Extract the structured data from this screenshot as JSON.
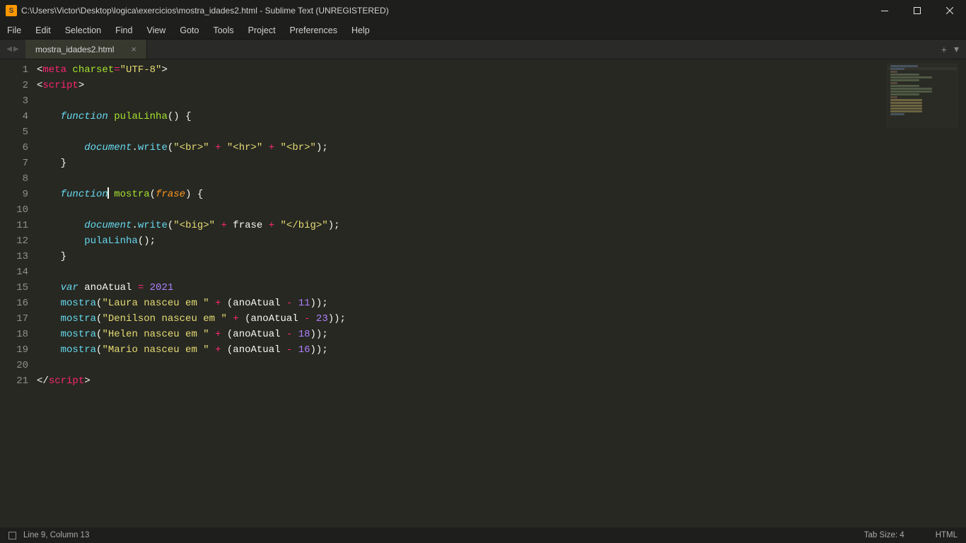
{
  "window": {
    "title": "C:\\Users\\Victor\\Desktop\\logica\\exercicios\\mostra_idades2.html - Sublime Text (UNREGISTERED)",
    "app_icon_letter": "S"
  },
  "menu": {
    "items": [
      "File",
      "Edit",
      "Selection",
      "Find",
      "View",
      "Goto",
      "Tools",
      "Project",
      "Preferences",
      "Help"
    ]
  },
  "tabs": {
    "open": [
      {
        "label": "mostra_idades2.html"
      }
    ],
    "add_tab_glyph": "+",
    "dropdown_glyph": "▾"
  },
  "editor": {
    "active_line": 9,
    "line_count": 21,
    "tokens": [
      [
        [
          "punc",
          "<"
        ],
        [
          "tag",
          "meta"
        ],
        [
          "punc",
          " "
        ],
        [
          "attr",
          "charset"
        ],
        [
          "op",
          "="
        ],
        [
          "str",
          "\"UTF-8\""
        ],
        [
          "punc",
          ">"
        ]
      ],
      [
        [
          "punc",
          "<"
        ],
        [
          "tag",
          "script"
        ],
        [
          "punc",
          ">"
        ]
      ],
      [],
      [
        [
          "punc",
          "    "
        ],
        [
          "kw",
          "function"
        ],
        [
          "punc",
          " "
        ],
        [
          "fn",
          "pulaLinha"
        ],
        [
          "punc",
          "() {"
        ]
      ],
      [],
      [
        [
          "punc",
          "        "
        ],
        [
          "obj",
          "document"
        ],
        [
          "punc",
          "."
        ],
        [
          "kw2",
          "write"
        ],
        [
          "punc",
          "("
        ],
        [
          "str",
          "\"<br>\""
        ],
        [
          "punc",
          " "
        ],
        [
          "op",
          "+"
        ],
        [
          "punc",
          " "
        ],
        [
          "str",
          "\"<hr>\""
        ],
        [
          "punc",
          " "
        ],
        [
          "op",
          "+"
        ],
        [
          "punc",
          " "
        ],
        [
          "str",
          "\"<br>\""
        ],
        [
          "punc",
          ");"
        ]
      ],
      [
        [
          "punc",
          "    }"
        ]
      ],
      [],
      [
        [
          "punc",
          "    "
        ],
        [
          "kw",
          "function"
        ],
        [
          "cursor",
          ""
        ],
        [
          "punc",
          " "
        ],
        [
          "fn",
          "mostra"
        ],
        [
          "punc",
          "("
        ],
        [
          "par",
          "frase"
        ],
        [
          "punc",
          ") {"
        ]
      ],
      [],
      [
        [
          "punc",
          "        "
        ],
        [
          "obj",
          "document"
        ],
        [
          "punc",
          "."
        ],
        [
          "kw2",
          "write"
        ],
        [
          "punc",
          "("
        ],
        [
          "str",
          "\"<big>\""
        ],
        [
          "punc",
          " "
        ],
        [
          "op",
          "+"
        ],
        [
          "punc",
          " frase "
        ],
        [
          "op",
          "+"
        ],
        [
          "punc",
          " "
        ],
        [
          "str",
          "\"</big>\""
        ],
        [
          "punc",
          ");"
        ]
      ],
      [
        [
          "punc",
          "        "
        ],
        [
          "kw2",
          "pulaLinha"
        ],
        [
          "punc",
          "();"
        ]
      ],
      [
        [
          "punc",
          "    }"
        ]
      ],
      [],
      [
        [
          "punc",
          "    "
        ],
        [
          "kw",
          "var"
        ],
        [
          "punc",
          " anoAtual "
        ],
        [
          "op",
          "="
        ],
        [
          "punc",
          " "
        ],
        [
          "num",
          "2021"
        ]
      ],
      [
        [
          "punc",
          "    "
        ],
        [
          "kw2",
          "mostra"
        ],
        [
          "punc",
          "("
        ],
        [
          "str",
          "\"Laura nasceu em \""
        ],
        [
          "punc",
          " "
        ],
        [
          "op",
          "+"
        ],
        [
          "punc",
          " (anoAtual "
        ],
        [
          "op",
          "-"
        ],
        [
          "punc",
          " "
        ],
        [
          "num",
          "11"
        ],
        [
          "punc",
          "));"
        ]
      ],
      [
        [
          "punc",
          "    "
        ],
        [
          "kw2",
          "mostra"
        ],
        [
          "punc",
          "("
        ],
        [
          "str",
          "\"Denilson nasceu em \""
        ],
        [
          "punc",
          " "
        ],
        [
          "op",
          "+"
        ],
        [
          "punc",
          " (anoAtual "
        ],
        [
          "op",
          "-"
        ],
        [
          "punc",
          " "
        ],
        [
          "num",
          "23"
        ],
        [
          "punc",
          "));"
        ]
      ],
      [
        [
          "punc",
          "    "
        ],
        [
          "kw2",
          "mostra"
        ],
        [
          "punc",
          "("
        ],
        [
          "str",
          "\"Helen nasceu em \""
        ],
        [
          "punc",
          " "
        ],
        [
          "op",
          "+"
        ],
        [
          "punc",
          " (anoAtual "
        ],
        [
          "op",
          "-"
        ],
        [
          "punc",
          " "
        ],
        [
          "num",
          "18"
        ],
        [
          "punc",
          "));"
        ]
      ],
      [
        [
          "punc",
          "    "
        ],
        [
          "kw2",
          "mostra"
        ],
        [
          "punc",
          "("
        ],
        [
          "str",
          "\"Mario nasceu em \""
        ],
        [
          "punc",
          " "
        ],
        [
          "op",
          "+"
        ],
        [
          "punc",
          " (anoAtual "
        ],
        [
          "op",
          "-"
        ],
        [
          "punc",
          " "
        ],
        [
          "num",
          "16"
        ],
        [
          "punc",
          "));"
        ]
      ],
      [],
      [
        [
          "punc",
          "</"
        ],
        [
          "tag",
          "script"
        ],
        [
          "punc",
          ">"
        ]
      ]
    ]
  },
  "status": {
    "position": "Line 9, Column 13",
    "tab_size": "Tab Size: 4",
    "syntax": "HTML"
  }
}
